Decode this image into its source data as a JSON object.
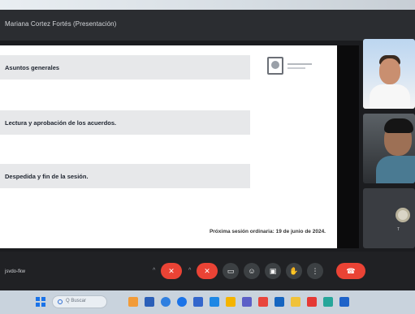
{
  "window": {
    "title": "Mariana Cortez Fortés (Presentación)"
  },
  "slide": {
    "rows": [
      {
        "label": "Asuntos generales"
      },
      {
        "label": "Lectura y aprobación de los acuerdos."
      },
      {
        "label": "Despedida y fin de la sesión."
      }
    ],
    "footer": "Próxima sesión ordinaria: 19 de junio de 2024."
  },
  "participants": [
    {
      "name": ""
    },
    {
      "name": ""
    },
    {
      "name": "T"
    }
  ],
  "meet": {
    "meeting_name": "jsvdo-fkw",
    "controls": [
      {
        "icon": "mic-off-icon",
        "symbol": "✕"
      },
      {
        "icon": "camera-off-icon",
        "symbol": "✕"
      },
      {
        "icon": "captions-icon",
        "symbol": "▭"
      },
      {
        "icon": "emoji-icon",
        "symbol": "☺"
      },
      {
        "icon": "present-icon",
        "symbol": "▣"
      },
      {
        "icon": "raise-hand-icon",
        "symbol": "✋"
      },
      {
        "icon": "more-options-icon",
        "symbol": "⋮"
      },
      {
        "icon": "leave-call-icon",
        "symbol": "☎"
      }
    ],
    "colors": {
      "danger": "#ea4335",
      "control_grey": "#3c4043",
      "bar_bg": "#202124"
    }
  },
  "taskbar": {
    "search_placeholder": "Q Buscar",
    "icons": [
      "widgets-icon",
      "file-explorer-icon",
      "edge-icon",
      "chrome-icon",
      "mail-icon",
      "store-icon",
      "photos-icon",
      "teams-icon",
      "settings-icon"
    ]
  }
}
